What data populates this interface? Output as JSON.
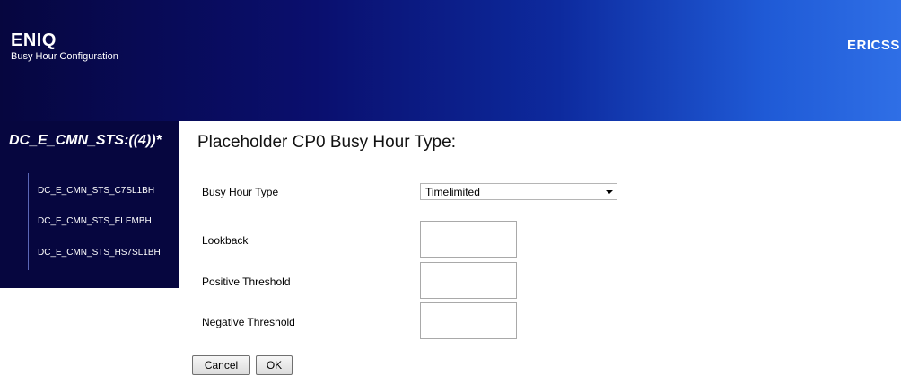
{
  "header": {
    "app_title": "ENIQ",
    "app_subtitle": "Busy Hour Configuration",
    "brand": "ERICSS"
  },
  "sidebar": {
    "title": "DC_E_CMN_STS:((4))*",
    "items": [
      {
        "label": "DC_E_CMN_STS_C7SL1BH"
      },
      {
        "label": "DC_E_CMN_STS_ELEMBH"
      },
      {
        "label": "DC_E_CMN_STS_HS7SL1BH"
      }
    ]
  },
  "main": {
    "title": "Placeholder CP0 Busy Hour Type:",
    "busy_hour_type": {
      "label": "Busy Hour Type",
      "selected": "Timelimited"
    },
    "lookback": {
      "label": "Lookback",
      "value": ""
    },
    "positive_threshold": {
      "label": "Positive Threshold",
      "value": ""
    },
    "negative_threshold": {
      "label": "Negative Threshold",
      "value": ""
    },
    "buttons": {
      "cancel": "Cancel",
      "ok": "OK"
    }
  },
  "colors": {
    "header_dark": "#06063f",
    "header_light": "#2f6fe6",
    "sidebar_bg": "#06063f"
  }
}
